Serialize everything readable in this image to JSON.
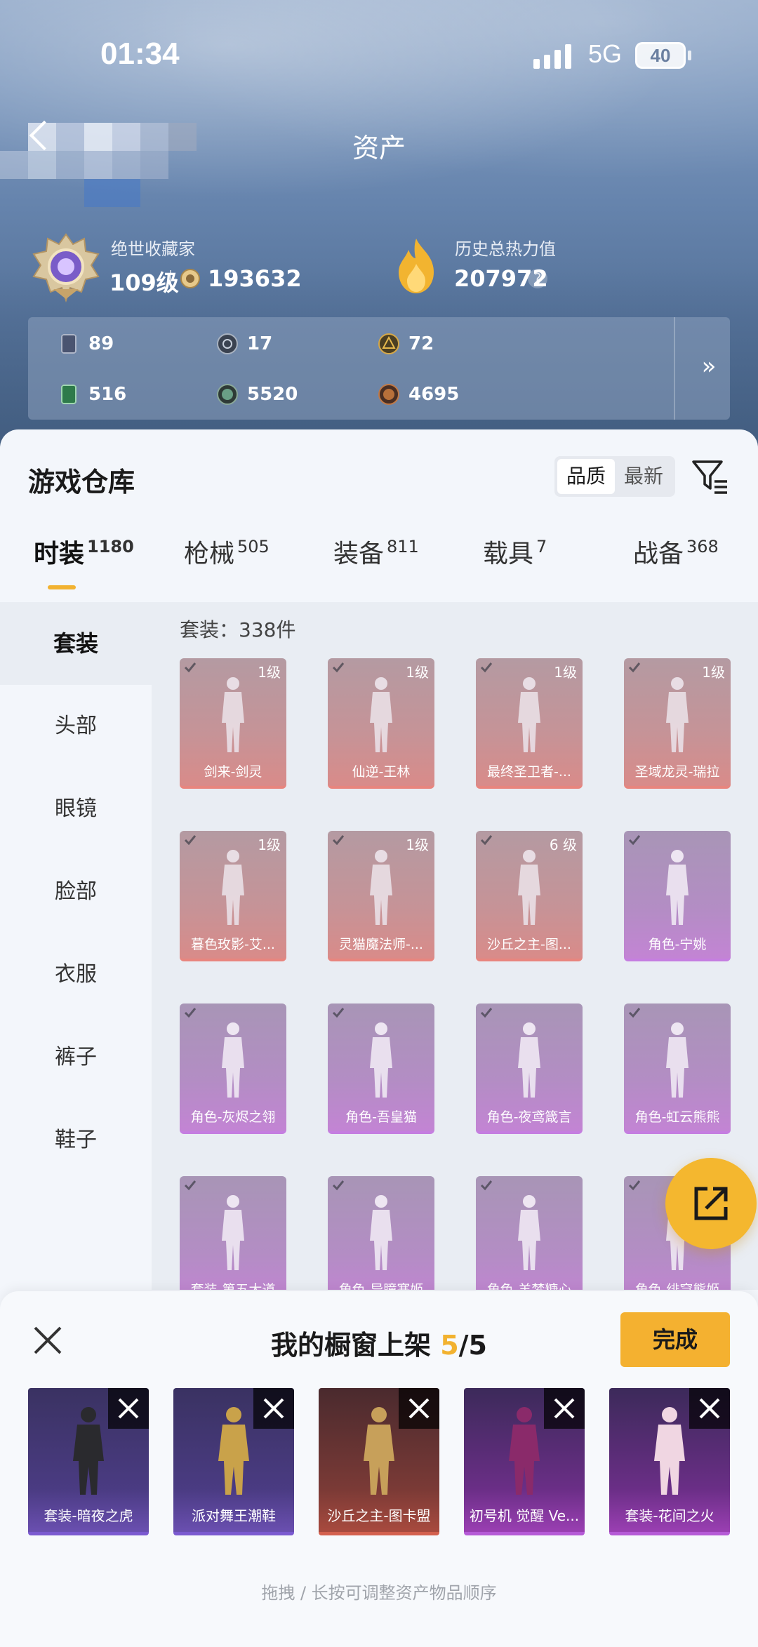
{
  "status_bar": {
    "time": "01:34",
    "network": "5G",
    "battery": "40"
  },
  "header": {
    "title": "资产"
  },
  "profile": {
    "collector_title": "绝世收藏家",
    "level": "109级",
    "coins": "193632",
    "heat_label": "历史总热力值",
    "heat_value": "207972",
    "help_glyph": "?"
  },
  "currencies": [
    {
      "icon": "card-icon",
      "value": "89",
      "color": "#4a5470"
    },
    {
      "icon": "silver-token-icon",
      "value": "17",
      "color": "#7a8796"
    },
    {
      "icon": "gold-token-icon",
      "value": "72",
      "color": "#c99a3a"
    },
    {
      "icon": "green-card-icon",
      "value": "516",
      "color": "#3e8a5a"
    },
    {
      "icon": "green-orb-icon",
      "value": "5520",
      "color": "#6a8f80"
    },
    {
      "icon": "bronze-orb-icon",
      "value": "4695",
      "color": "#a86a3c"
    }
  ],
  "more_arrow": "»",
  "warehouse": {
    "title": "游戏仓库",
    "sort_options": [
      "品质",
      "最新"
    ],
    "sort_active": "品质",
    "tabs": [
      {
        "label": "时装",
        "count": "1180"
      },
      {
        "label": "枪械",
        "count": "505"
      },
      {
        "label": "装备",
        "count": "811"
      },
      {
        "label": "载具",
        "count": "7"
      },
      {
        "label": "战备",
        "count": "368"
      }
    ],
    "side_nav": [
      "套装",
      "头部",
      "眼镜",
      "脸部",
      "衣服",
      "裤子",
      "鞋子"
    ],
    "count_label": "套装：338件",
    "items": [
      {
        "name": "剑来-剑灵",
        "badge": "1级",
        "rarity": "red"
      },
      {
        "name": "仙逆-王林",
        "badge": "1级",
        "rarity": "red"
      },
      {
        "name": "最终圣卫者-...",
        "badge": "1级",
        "rarity": "red"
      },
      {
        "name": "圣域龙灵-瑞拉",
        "badge": "1级",
        "rarity": "red"
      },
      {
        "name": "暮色玫影-艾...",
        "badge": "1级",
        "rarity": "red"
      },
      {
        "name": "灵猫魔法师-...",
        "badge": "1级",
        "rarity": "red"
      },
      {
        "name": "沙丘之主-图...",
        "badge": "6 级",
        "rarity": "red"
      },
      {
        "name": "角色-宁姚",
        "badge": "",
        "rarity": "purple"
      },
      {
        "name": "角色-灰烬之翎",
        "badge": "",
        "rarity": "purple"
      },
      {
        "name": "角色-吾皇猫",
        "badge": "",
        "rarity": "purple"
      },
      {
        "name": "角色-夜鸢箴言",
        "badge": "",
        "rarity": "purple"
      },
      {
        "name": "角色-虹云熊熊",
        "badge": "",
        "rarity": "purple"
      },
      {
        "name": "套装-第五大道",
        "badge": "",
        "rarity": "purple"
      },
      {
        "name": "角色-异瞳寒姬",
        "badge": "",
        "rarity": "purple"
      },
      {
        "name": "角色-羊梦糖心",
        "badge": "",
        "rarity": "purple"
      },
      {
        "name": "角色-绯穹熊姬",
        "badge": "",
        "rarity": "purple"
      }
    ]
  },
  "showcase": {
    "title_prefix": "我的橱窗上架 ",
    "current": "5",
    "total": "/5",
    "done_label": "完成",
    "slots": [
      {
        "name": "套装-暗夜之虎",
        "style": "dark-purple"
      },
      {
        "name": "派对舞王潮鞋",
        "style": "dark-purple"
      },
      {
        "name": "沙丘之主-图卡盟",
        "style": "red"
      },
      {
        "name": "初号机 觉醒 Ve...",
        "style": "magenta"
      },
      {
        "name": "套装-花间之火",
        "style": "magenta"
      }
    ],
    "hint": "拖拽 / 长按可调整资产物品顺序"
  }
}
